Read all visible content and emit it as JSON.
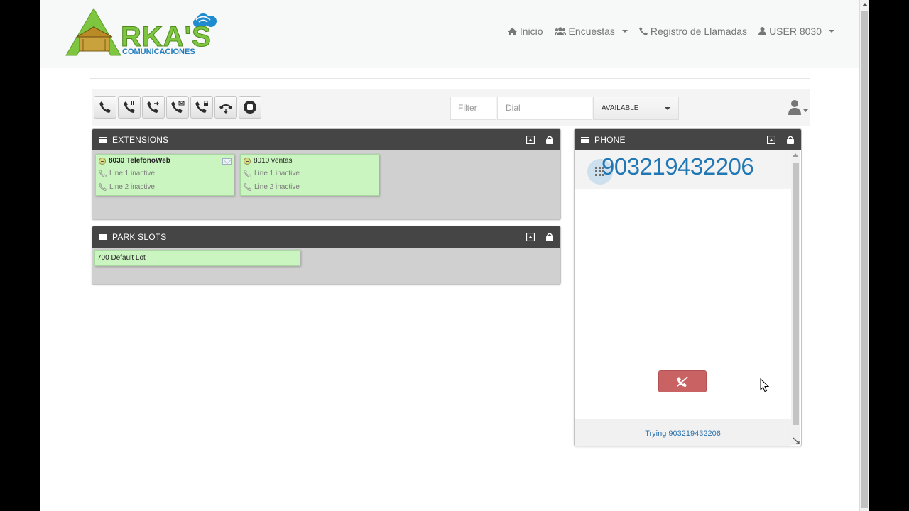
{
  "brand": {
    "logo_text": "RKA'S",
    "logo_sub": "COMUNICACIONES",
    "colors": {
      "green": "#7ec540",
      "cloud": "#1f8ccf"
    }
  },
  "nav": {
    "items": [
      {
        "label": "Inicio",
        "icon": "home-icon"
      },
      {
        "label": "Encuestas",
        "icon": "users-icon",
        "dropdown": true
      },
      {
        "label": "Registro de Llamadas",
        "icon": "phone-icon"
      },
      {
        "label": "USER 8030",
        "icon": "user-icon",
        "dropdown": true
      }
    ]
  },
  "toolbar": {
    "buttons": [
      "call-icon",
      "hold-icon",
      "transfer-icon",
      "voicemail-icon",
      "lock-line-icon",
      "pickup-icon",
      "record-icon"
    ],
    "filter_placeholder": "Filter",
    "dial_placeholder": "Dial",
    "status_value": "AVAILABLE"
  },
  "extensions_panel": {
    "title": "EXTENSIONS",
    "cards": [
      {
        "name": "8030 TelefonoWeb",
        "bold": true,
        "has_mail": true,
        "lines": [
          "Line 1 inactive",
          "Line 2 inactive"
        ]
      },
      {
        "name": "8010 ventas",
        "bold": false,
        "has_mail": false,
        "lines": [
          "Line 1 inactive",
          "Line 2 inactive"
        ]
      }
    ]
  },
  "park_panel": {
    "title": "PARK SLOTS",
    "slots": [
      "700 Default Lot"
    ]
  },
  "phone_panel": {
    "title": "PHONE",
    "number": "903219432206",
    "status": "Trying 903219432206",
    "colors": {
      "number": "#2277b5",
      "hangup": "#c96263"
    }
  }
}
